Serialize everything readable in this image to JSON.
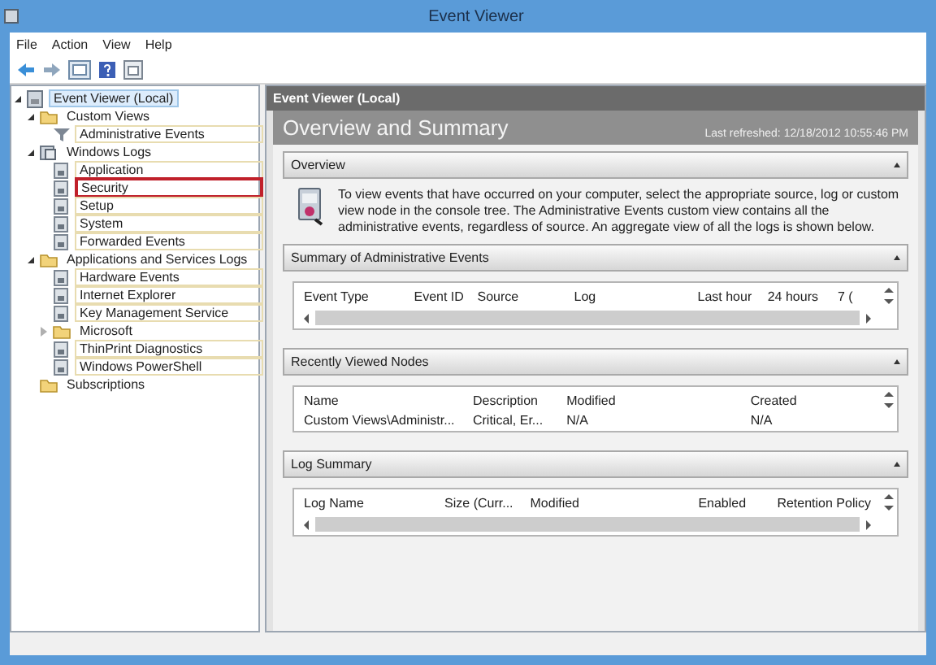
{
  "window": {
    "title": "Event Viewer"
  },
  "menu": [
    "File",
    "Action",
    "View",
    "Help"
  ],
  "tree": [
    {
      "label": "Event Viewer (Local)",
      "kind": "viewer",
      "selected": true,
      "marked": false,
      "expanded": true,
      "children": [
        {
          "label": "Custom Views",
          "kind": "folder",
          "selected": false,
          "marked": false,
          "expanded": true,
          "children": [
            {
              "label": "Administrative Events",
              "kind": "filter",
              "selected": false,
              "marked": false
            }
          ]
        },
        {
          "label": "Windows Logs",
          "kind": "logs",
          "selected": false,
          "marked": false,
          "expanded": true,
          "children": [
            {
              "label": "Application",
              "kind": "log",
              "selected": false,
              "marked": false
            },
            {
              "label": "Security",
              "kind": "log",
              "selected": false,
              "marked": true
            },
            {
              "label": "Setup",
              "kind": "log",
              "selected": false,
              "marked": false
            },
            {
              "label": "System",
              "kind": "log",
              "selected": false,
              "marked": false
            },
            {
              "label": "Forwarded Events",
              "kind": "log",
              "selected": false,
              "marked": false
            }
          ]
        },
        {
          "label": "Applications and Services Logs",
          "kind": "folder",
          "selected": false,
          "marked": false,
          "expanded": true,
          "children": [
            {
              "label": "Hardware Events",
              "kind": "log",
              "selected": false,
              "marked": false
            },
            {
              "label": "Internet Explorer",
              "kind": "log",
              "selected": false,
              "marked": false
            },
            {
              "label": "Key Management Service",
              "kind": "log",
              "selected": false,
              "marked": false
            },
            {
              "label": "Microsoft",
              "kind": "folder",
              "selected": false,
              "marked": false,
              "expanded": false
            },
            {
              "label": "ThinPrint Diagnostics",
              "kind": "log",
              "selected": false,
              "marked": false
            },
            {
              "label": "Windows PowerShell",
              "kind": "log",
              "selected": false,
              "marked": false
            }
          ]
        },
        {
          "label": "Subscriptions",
          "kind": "folder",
          "selected": false,
          "marked": false
        }
      ]
    }
  ],
  "pane": {
    "header": "Event Viewer (Local)",
    "title": "Overview and Summary",
    "refreshed": "Last refreshed: 12/18/2012 10:55:46 PM",
    "sections": [
      {
        "kind": "text",
        "title": "Overview",
        "expanded": true,
        "text": "To view events that have occurred on your computer, select the appropriate source, log or custom view node in the console tree. The Administrative Events custom view contains all the administrative events, regardless of source. An aggregate view of all the logs is shown below."
      },
      {
        "kind": "scroll-table",
        "title": "Summary of Administrative Events",
        "expanded": true,
        "columns": [
          "Event Type",
          "Event ID",
          "Source",
          "Log",
          "Last hour",
          "24 hours",
          "7 ("
        ]
      },
      {
        "kind": "table",
        "title": "Recently Viewed Nodes",
        "expanded": true,
        "columns": [
          "Name",
          "Description",
          "Modified",
          "Created"
        ],
        "rows": [
          [
            "Custom Views\\Administr...",
            "Critical, Er...",
            "N/A",
            "N/A"
          ]
        ]
      },
      {
        "kind": "scroll-table",
        "title": "Log Summary",
        "expanded": true,
        "columns": [
          "Log Name",
          "Size (Curr...",
          "Modified",
          "Enabled",
          "Retention Policy"
        ]
      }
    ]
  }
}
